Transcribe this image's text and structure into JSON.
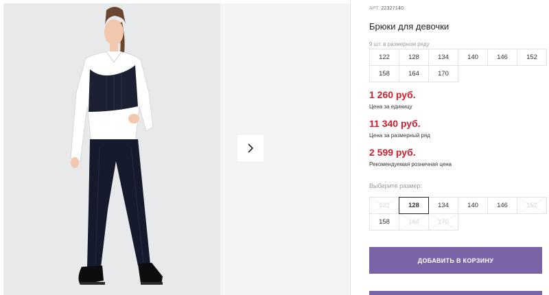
{
  "product": {
    "art_label": "АРТ.",
    "art_number": "22327140",
    "title": "Брюки для девочки"
  },
  "pack": {
    "label": "9 шт. в размерном ряду",
    "sizes": [
      "122",
      "128",
      "134",
      "140",
      "146",
      "152",
      "158",
      "164",
      "170"
    ]
  },
  "prices": {
    "unit_price": "1 260 руб.",
    "unit_caption": "Цена за единицу",
    "pack_price": "11 340 руб.",
    "pack_caption": "Цена за размерный ряд",
    "retail_price": "2 599 руб.",
    "retail_caption": "Рекомендуемая розничная цена"
  },
  "size_select": {
    "label": "Выберите размер:",
    "options": [
      {
        "label": "122",
        "available": false
      },
      {
        "label": "128",
        "available": true,
        "selected": true
      },
      {
        "label": "134",
        "available": true
      },
      {
        "label": "140",
        "available": true
      },
      {
        "label": "146",
        "available": true
      },
      {
        "label": "152",
        "available": false
      },
      {
        "label": "158",
        "available": true
      },
      {
        "label": "164",
        "available": false
      },
      {
        "label": "170",
        "available": false
      }
    ]
  },
  "actions": {
    "add_to_cart": "ДОБАВИТЬ В КОРЗИНУ"
  },
  "colors": {
    "accent": "#7b63a8",
    "price": "#d31c2c"
  },
  "icons": {
    "next": "chevron-right-icon"
  }
}
